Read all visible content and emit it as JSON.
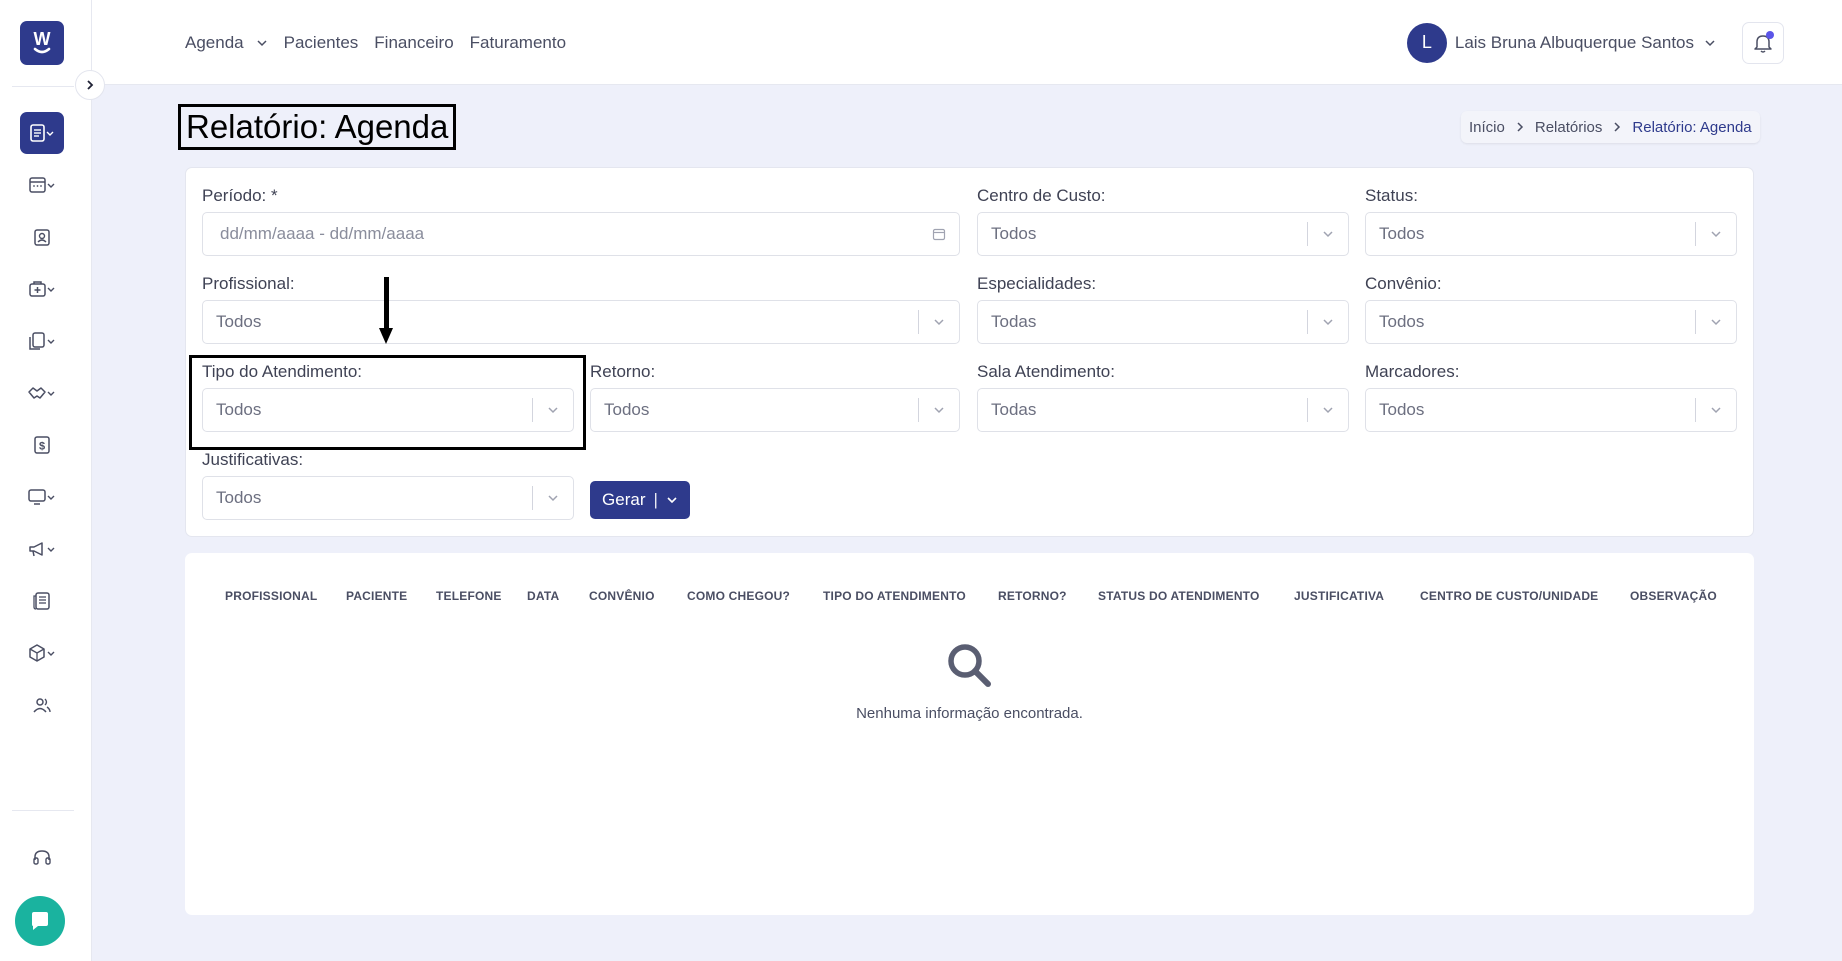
{
  "brand": {
    "logo_letter": "W"
  },
  "header": {
    "nav": [
      {
        "label": "Agenda"
      },
      {
        "label": "Pacientes"
      },
      {
        "label": "Financeiro"
      },
      {
        "label": "Faturamento"
      }
    ],
    "user": {
      "initial": "L",
      "name": "Lais Bruna Albuquerque Santos"
    }
  },
  "page": {
    "title": "Relatório: Agenda",
    "breadcrumb": [
      "Início",
      "Relatórios",
      "Relatório: Agenda"
    ]
  },
  "filters": {
    "periodo": {
      "label": "Período: *",
      "placeholder": "dd/mm/aaaa - dd/mm/aaaa"
    },
    "centro_custo": {
      "label": "Centro de Custo:",
      "value": "Todos"
    },
    "status": {
      "label": "Status:",
      "value": "Todos"
    },
    "profissional": {
      "label": "Profissional:",
      "value": "Todos"
    },
    "especialidades": {
      "label": "Especialidades:",
      "value": "Todas"
    },
    "convenio": {
      "label": "Convênio:",
      "value": "Todos"
    },
    "tipo_atendimento": {
      "label": "Tipo do Atendimento:",
      "value": "Todos"
    },
    "retorno": {
      "label": "Retorno:",
      "value": "Todos"
    },
    "sala_atendimento": {
      "label": "Sala Atendimento:",
      "value": "Todas"
    },
    "marcadores": {
      "label": "Marcadores:",
      "value": "Todos"
    },
    "justificativas": {
      "label": "Justificativas:",
      "value": "Todos"
    },
    "generate_label": "Gerar"
  },
  "table": {
    "columns": [
      "PROFISSIONAL",
      "PACIENTE",
      "TELEFONE",
      "DATA",
      "CONVÊNIO",
      "COMO CHEGOU?",
      "TIPO DO ATENDIMENTO",
      "RETORNO?",
      "STATUS DO ATENDIMENTO",
      "JUSTIFICATIVA",
      "CENTRO DE CUSTO/UNIDADE",
      "OBSERVAÇÃO"
    ],
    "empty_message": "Nenhuma informação encontrada."
  },
  "sidebar": {
    "items": [
      {
        "icon": "reports-icon",
        "active": true
      },
      {
        "icon": "calendar-icon"
      },
      {
        "icon": "patient-badge-icon"
      },
      {
        "icon": "medical-bag-icon"
      },
      {
        "icon": "documents-icon"
      },
      {
        "icon": "handshake-icon"
      },
      {
        "icon": "dollar-icon"
      },
      {
        "icon": "monitor-icon"
      },
      {
        "icon": "megaphone-icon"
      },
      {
        "icon": "newspaper-icon"
      },
      {
        "icon": "box-icon"
      },
      {
        "icon": "users-icon"
      },
      {
        "icon": "headset-icon"
      },
      {
        "icon": "chat-icon"
      }
    ]
  },
  "colors": {
    "primary": "#2e3a8c",
    "accent": "#1ab39f",
    "background": "#eef0fa"
  }
}
